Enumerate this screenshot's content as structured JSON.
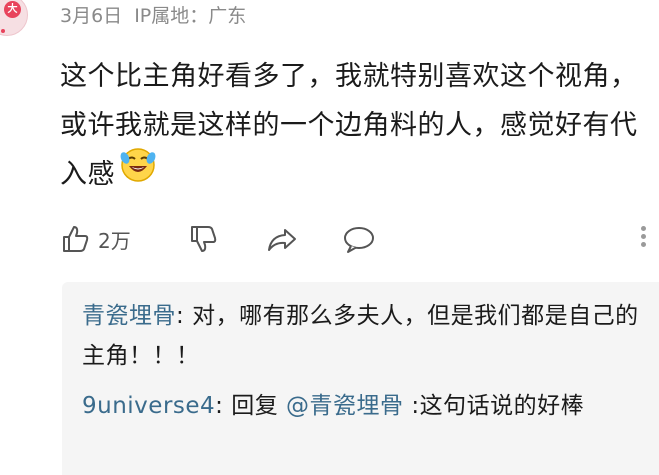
{
  "comment": {
    "avatar_badge": "大",
    "date": "3月6日",
    "ip_location": "IP属地：广东",
    "text": "这个比主角好看多了，我就特别喜欢这个视角，或许我就是这样的一个边角料的人，感觉好有代入感",
    "emoji": "laughing-crying-emoji"
  },
  "actions": {
    "like_count": "2万",
    "like_icon": "thumbs-up-icon",
    "dislike_icon": "thumbs-down-icon",
    "share_icon": "share-arrow-icon",
    "comment_icon": "comment-bubble-icon",
    "more_icon": "more-vertical-icon"
  },
  "replies": [
    {
      "author": "青瓷埋骨",
      "colon": ": ",
      "text": "对，哪有那么多夫人，但是我们都是自己的主角！！！"
    },
    {
      "author": "9universe4",
      "colon": ": ",
      "reply_label": "回复 ",
      "mention": "@青瓷埋骨",
      "text": " :这句话说的好棒"
    }
  ],
  "colors": {
    "name_link": "#3a6b8c",
    "meta_gray": "#8a8a8a",
    "reply_bg": "#f5f5f5",
    "avatar_red": "#e8435c"
  }
}
